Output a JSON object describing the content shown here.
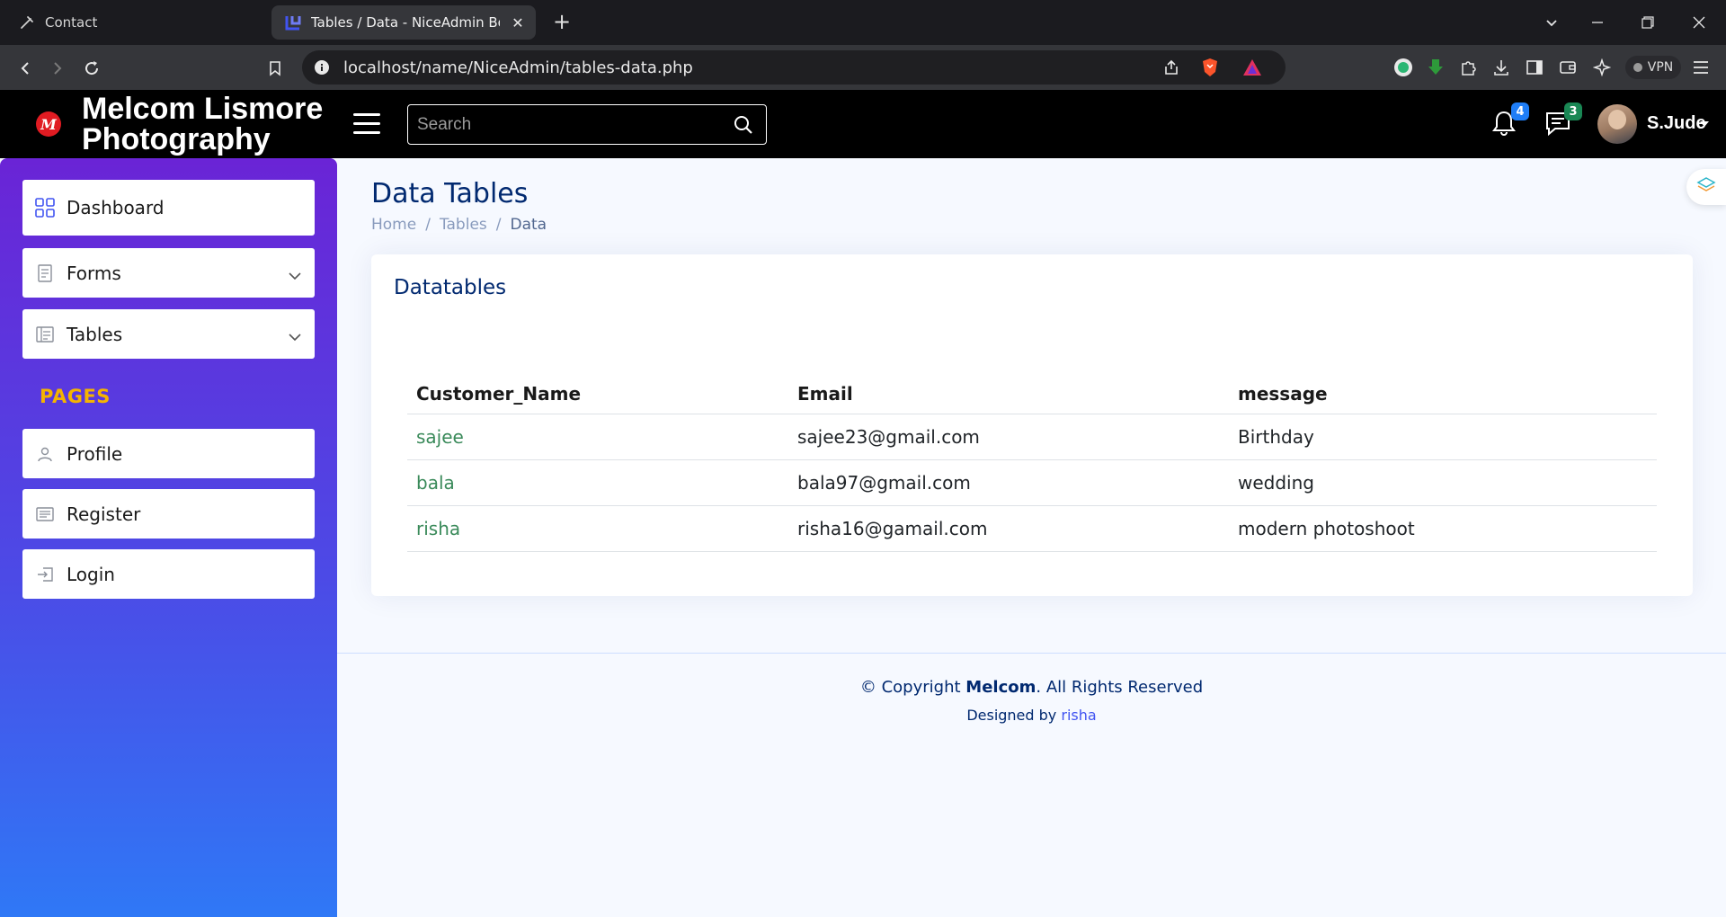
{
  "browser": {
    "tabs": [
      {
        "title": "Contact",
        "icon": "contact-tab-icon",
        "active": false
      },
      {
        "title": "Tables / Data - NiceAdmin Bootstrap Template",
        "icon": "niceadmin-favicon-icon",
        "active": true
      }
    ],
    "url": "localhost/name/NiceAdmin/tables-data.php",
    "vpn_label": "VPN"
  },
  "header": {
    "brand": "Melcom Lismore Photography",
    "logo_letter": "M",
    "search_placeholder": "Search",
    "notifications_count": "4",
    "messages_count": "3",
    "user_name": "S.Jude"
  },
  "sidebar": {
    "items": [
      {
        "label": "Dashboard",
        "icon": "grid-icon"
      },
      {
        "label": "Forms",
        "icon": "journal-icon",
        "expandable": true
      },
      {
        "label": "Tables",
        "icon": "layout-text-icon",
        "expandable": true
      }
    ],
    "heading": "PAGES",
    "pages": [
      {
        "label": "Profile",
        "icon": "person-icon"
      },
      {
        "label": "Register",
        "icon": "card-list-icon"
      },
      {
        "label": "Login",
        "icon": "box-arrow-in-right-icon"
      }
    ]
  },
  "main": {
    "page_title": "Data Tables",
    "breadcrumb": [
      "Home",
      "Tables",
      "Data"
    ],
    "card_title": "Datatables",
    "table": {
      "columns": [
        "Customer_Name",
        "Email",
        "message"
      ],
      "rows": [
        [
          "sajee",
          "sajee23@gmail.com",
          "Birthday"
        ],
        [
          "bala",
          "bala97@gmail.com",
          "wedding"
        ],
        [
          "risha",
          "risha16@gamail.com",
          "modern photoshoot"
        ]
      ]
    }
  },
  "footer": {
    "copyright_prefix": "© Copyright",
    "company": "Melcom",
    "rights": ". All Rights Reserved",
    "designed_by": "Designed by",
    "designer": "risha"
  },
  "colors": {
    "sidebar_gradient_top": "#6a24d6",
    "sidebar_gradient_bottom": "#2f78f6",
    "heading_accent": "#f5b400",
    "title_navy": "#012970",
    "name_link_green": "#3a8a5a"
  }
}
